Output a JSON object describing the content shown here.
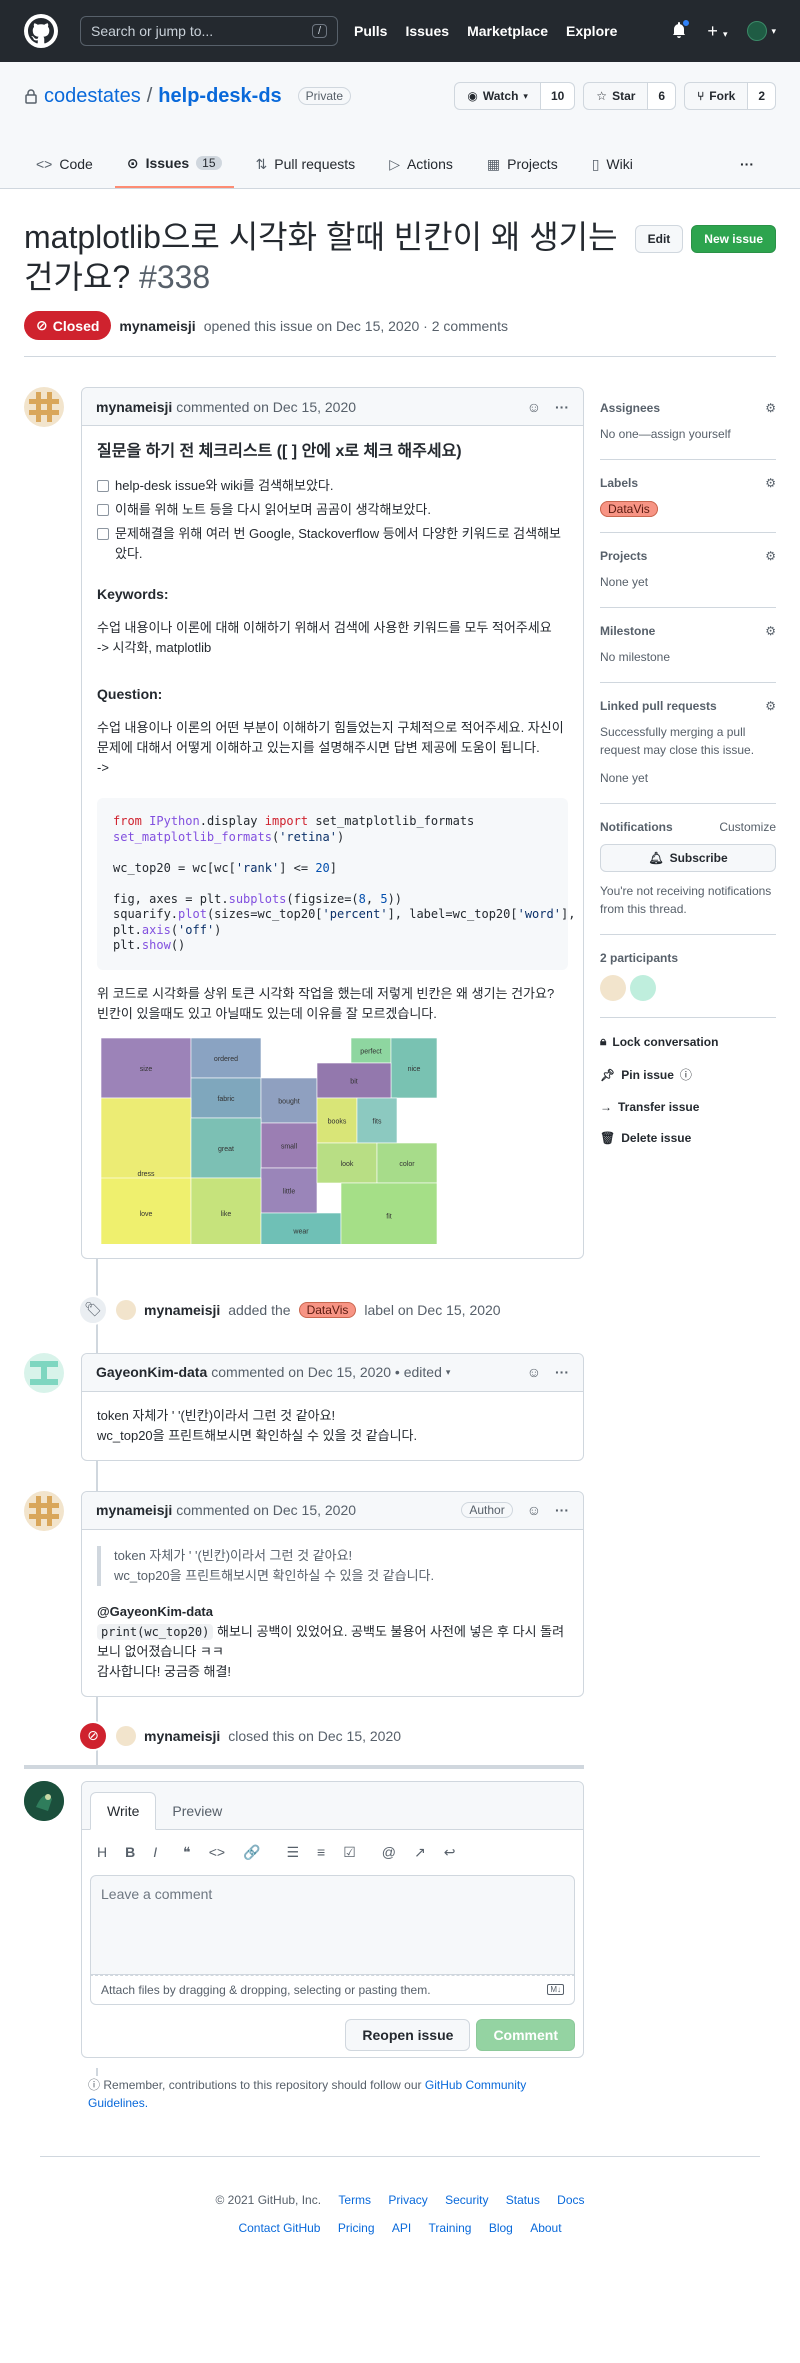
{
  "header": {
    "search_placeholder": "Search or jump to...",
    "slash": "/",
    "nav": [
      "Pulls",
      "Issues",
      "Marketplace",
      "Explore"
    ]
  },
  "repo": {
    "owner": "codestates",
    "sep": "/",
    "name": "help-desk-ds",
    "visibility": "Private",
    "watch_label": "Watch",
    "watch_count": "10",
    "star_label": "Star",
    "star_count": "6",
    "fork_label": "Fork",
    "fork_count": "2",
    "tabs": [
      {
        "label": "Code",
        "icon": "code-icon"
      },
      {
        "label": "Issues",
        "count": "15",
        "icon": "issue-icon"
      },
      {
        "label": "Pull requests",
        "icon": "pr-icon"
      },
      {
        "label": "Actions",
        "icon": "play-icon"
      },
      {
        "label": "Projects",
        "icon": "table-icon"
      },
      {
        "label": "Wiki",
        "icon": "book-icon"
      }
    ]
  },
  "issue": {
    "title": "matplotlib으로 시각화 할때 빈칸이 왜 생기는건가요?",
    "number": "#338",
    "edit_label": "Edit",
    "new_label": "New issue",
    "state": "Closed",
    "author": "mynameisji",
    "opened_text": "opened this issue on Dec 15, 2020 · 2 comments"
  },
  "comment1": {
    "author": "mynameisji",
    "meta": "commented on Dec 15, 2020",
    "heading": "질문을 하기 전 체크리스트 ([ ] 안에 x로 체크 해주세요)",
    "checks": [
      "help-desk issue와 wiki를 검색해보았다.",
      "이해를 위해 노트 등을 다시 읽어보며 곰곰이 생각해보았다.",
      "문제해결을 위해 여러 번 Google, Stackoverflow 등에서 다양한 키워드로 검색해보았다."
    ],
    "keywords_h": "Keywords:",
    "keywords_text": "수업 내용이나 이론에 대해 이해하기 위해서 검색에 사용한 키워드를 모두 적어주세요",
    "keywords_val": "-> 시각화, matplotlib",
    "question_h": "Question:",
    "question_text": "수업 내용이나 이론의 어떤 부분이 이해하기 힘들었는지 구체적으로 적어주세요. 자신이 문제에 대해서 어떻게 이해하고 있는지를 설명해주시면 답변 제공에 도움이 됩니다.",
    "question_arrow": "->",
    "after_code": "위 코드로 시각화를 상위 토큰 시각화 작업을 했는데 저렇게 빈칸은 왜 생기는 건가요? 빈칸이 있을때도 있고 아닐때도 있는데 이유를 잘 모르겠습니다."
  },
  "treemap": {
    "cells": [
      {
        "word": "size",
        "color": "#9c83b8"
      },
      {
        "word": "ordered",
        "color": "#8aa3c2"
      },
      {
        "word": "perfect",
        "color": "#8ed6a0"
      },
      {
        "word": "nice",
        "color": "#79c2b2"
      },
      {
        "word": "fabric",
        "color": "#7fa7bd"
      },
      {
        "word": "bought",
        "color": "#8fa0c0"
      },
      {
        "word": "bit",
        "color": "#9378ad"
      },
      {
        "word": "dress",
        "color": "#ecec74"
      },
      {
        "word": "small",
        "color": "#9b7eb3"
      },
      {
        "word": "books",
        "color": "#d9e577"
      },
      {
        "word": "fits",
        "color": "#8cc9c0"
      },
      {
        "word": "great",
        "color": "#7cc0b4"
      },
      {
        "word": "little",
        "color": "#9a85b9"
      },
      {
        "word": "look",
        "color": "#b8de84"
      },
      {
        "word": "color",
        "color": "#a7dc8a"
      },
      {
        "word": "love",
        "color": "#eff06e"
      },
      {
        "word": "like",
        "color": "#c6e37c"
      },
      {
        "word": "wear",
        "color": "#6fc0b6"
      },
      {
        "word": "fit",
        "color": "#a5df87"
      }
    ]
  },
  "event_label": {
    "actor": "mynameisji",
    "pre": "added the",
    "label": "DataVis",
    "post": "label on Dec 15, 2020"
  },
  "comment2": {
    "author": "GayeonKim-data",
    "meta": "commented on Dec 15, 2020 • edited",
    "line1": "token 자체가 ' '(빈칸)이라서 그런 것 같아요!",
    "line2": "wc_top20을 프린트해보시면 확인하실 수 있을 것 같습니다."
  },
  "comment3": {
    "author": "mynameisji",
    "meta": "commented on Dec 15, 2020",
    "badge": "Author",
    "q1": "token 자체가 ' '(빈칸)이라서 그런 것 같아요!",
    "q2": "wc_top20을 프린트해보시면 확인하실 수 있을 것 같습니다.",
    "mention": "@GayeonKim-data",
    "code": "print(wc_top20)",
    "reply": "해보니 공백이 있었어요. 공백도 불용어 사전에 넣은 후 다시 돌려보니 없어졌습니다 ㅋㅋ",
    "thanks": "감사합니다! 궁금증 해결!"
  },
  "event_closed": {
    "actor": "mynameisji",
    "text": "closed this on Dec 15, 2020"
  },
  "editor": {
    "write": "Write",
    "preview": "Preview",
    "placeholder": "Leave a comment",
    "attach": "Attach files by dragging & dropping, selecting or pasting them.",
    "reopen": "Reopen issue",
    "comment": "Comment",
    "note_pre": "Remember, contributions to this repository should follow our",
    "note_link": "GitHub Community Guidelines."
  },
  "sidebar": {
    "assignees_h": "Assignees",
    "assignees_v": "No one—assign yourself",
    "labels_h": "Labels",
    "label": "DataVis",
    "projects_h": "Projects",
    "projects_v": "None yet",
    "milestone_h": "Milestone",
    "milestone_v": "No milestone",
    "linked_h": "Linked pull requests",
    "linked_v": "Successfully merging a pull request may close this issue.",
    "linked_v2": "None yet",
    "notif_h": "Notifications",
    "notif_customize": "Customize",
    "subscribe": "Subscribe",
    "notif_v": "You're not receiving notifications from this thread.",
    "participants": "2 participants",
    "lock": "Lock conversation",
    "pin": "Pin issue",
    "transfer": "Transfer issue",
    "delete": "Delete issue"
  },
  "footer": {
    "copyright": "© 2021 GitHub, Inc.",
    "links1": [
      "Terms",
      "Privacy",
      "Security",
      "Status",
      "Docs"
    ],
    "links2": [
      "Contact GitHub",
      "Pricing",
      "API",
      "Training",
      "Blog",
      "About"
    ]
  }
}
